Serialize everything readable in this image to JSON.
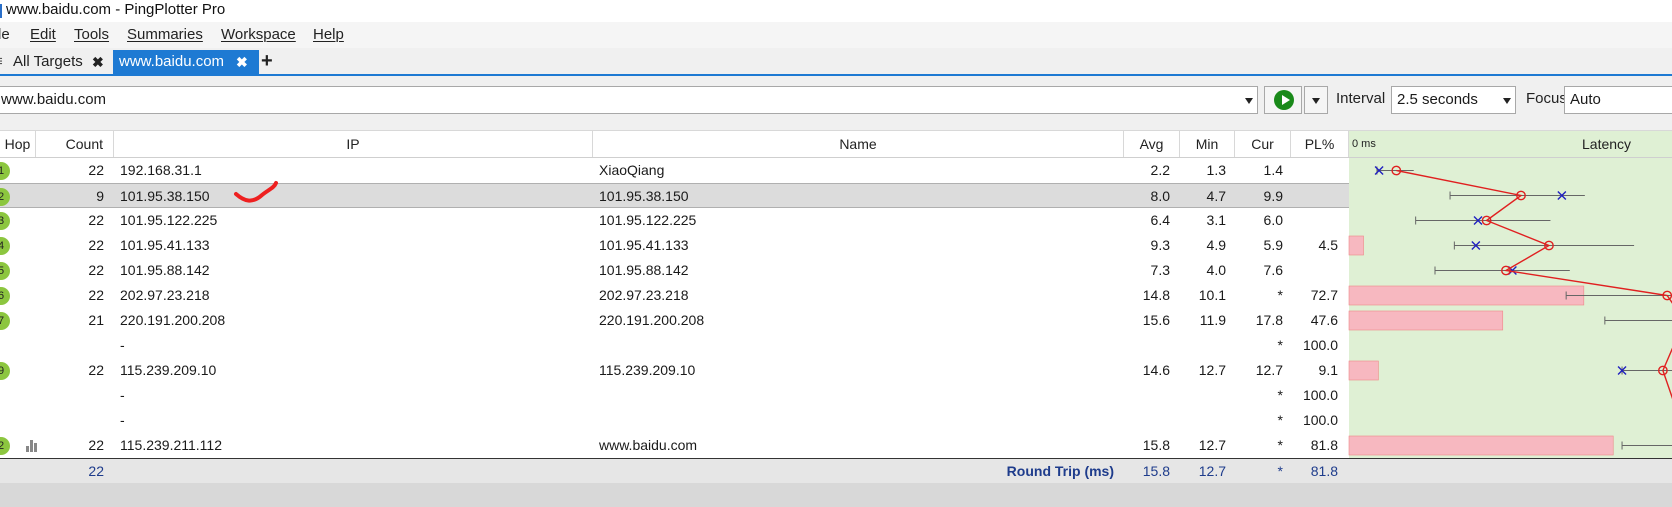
{
  "window": {
    "title": "www.baidu.com - PingPlotter Pro"
  },
  "menu": [
    "le",
    "Edit",
    "Tools",
    "Summaries",
    "Workspace",
    "Help"
  ],
  "tabs": [
    {
      "label": "All Targets",
      "active": false
    },
    {
      "label": "www.baidu.com",
      "active": true
    }
  ],
  "toolbar": {
    "target": "www.baidu.com",
    "interval_label": "Interval",
    "interval_value": "2.5 seconds",
    "focus_label": "Focus",
    "focus_value": "Auto"
  },
  "table": {
    "headers": {
      "hop": "Hop",
      "count": "Count",
      "ip": "IP",
      "name": "Name",
      "avg": "Avg",
      "min": "Min",
      "cur": "Cur",
      "pl": "PL%",
      "latency_scale": "0 ms",
      "latency": "Latency"
    },
    "rows": [
      {
        "hop": "1",
        "count": "22",
        "ip": "192.168.31.1",
        "name": "XiaoQiang",
        "avg": "2.2",
        "min": "1.3",
        "cur": "1.4",
        "pl": "",
        "pl_value": 0,
        "bar": false
      },
      {
        "hop": "2",
        "count": "9",
        "ip": "101.95.38.150",
        "name": "101.95.38.150",
        "avg": "8.0",
        "min": "4.7",
        "cur": "9.9",
        "pl": "",
        "pl_value": 0,
        "bar": false,
        "selected": true
      },
      {
        "hop": "3",
        "count": "22",
        "ip": "101.95.122.225",
        "name": "101.95.122.225",
        "avg": "6.4",
        "min": "3.1",
        "cur": "6.0",
        "pl": "",
        "pl_value": 0,
        "bar": false
      },
      {
        "hop": "4",
        "count": "22",
        "ip": "101.95.41.133",
        "name": "101.95.41.133",
        "avg": "9.3",
        "min": "4.9",
        "cur": "5.9",
        "pl": "4.5",
        "pl_value": 4.5,
        "bar": true
      },
      {
        "hop": "5",
        "count": "22",
        "ip": "101.95.88.142",
        "name": "101.95.88.142",
        "avg": "7.3",
        "min": "4.0",
        "cur": "7.6",
        "pl": "",
        "pl_value": 0,
        "bar": false
      },
      {
        "hop": "6",
        "count": "22",
        "ip": "202.97.23.218",
        "name": "202.97.23.218",
        "avg": "14.8",
        "min": "10.1",
        "cur": "*",
        "pl": "72.7",
        "pl_value": 72.7,
        "bar": true
      },
      {
        "hop": "7",
        "count": "21",
        "ip": "220.191.200.208",
        "name": "220.191.200.208",
        "avg": "15.6",
        "min": "11.9",
        "cur": "17.8",
        "pl": "47.6",
        "pl_value": 47.6,
        "bar": true
      },
      {
        "hop": "",
        "count": "",
        "ip": "-",
        "name": "",
        "avg": "",
        "min": "",
        "cur": "*",
        "pl": "100.0",
        "pl_value": 100,
        "bar": false
      },
      {
        "hop": "9",
        "count": "22",
        "ip": "115.239.209.10",
        "name": "115.239.209.10",
        "avg": "14.6",
        "min": "12.7",
        "cur": "12.7",
        "pl": "9.1",
        "pl_value": 9.1,
        "bar": true
      },
      {
        "hop": "",
        "count": "",
        "ip": "-",
        "name": "",
        "avg": "",
        "min": "",
        "cur": "*",
        "pl": "100.0",
        "pl_value": 100,
        "bar": false
      },
      {
        "hop": "",
        "count": "",
        "ip": "-",
        "name": "",
        "avg": "",
        "min": "",
        "cur": "*",
        "pl": "100.0",
        "pl_value": 100,
        "bar": false
      },
      {
        "hop": "2",
        "count": "22",
        "ip": "115.239.211.112",
        "name": "www.baidu.com",
        "avg": "15.8",
        "min": "12.7",
        "cur": "*",
        "pl": "81.8",
        "pl_value": 81.8,
        "bar": true,
        "graph_icon": "bar-chart-icon"
      }
    ],
    "footer": {
      "count": "22",
      "label": "Round Trip (ms)",
      "avg": "15.8",
      "min": "12.7",
      "cur": "*",
      "pl": "81.8"
    }
  },
  "colors": {
    "accent": "#1e7ad3",
    "hop_ok": "#8cc63f",
    "latency_bg": "#dff0d4",
    "loss_bar": "#f7b8c0",
    "latency_line": "#e02020",
    "current_marker": "#2020c0"
  }
}
